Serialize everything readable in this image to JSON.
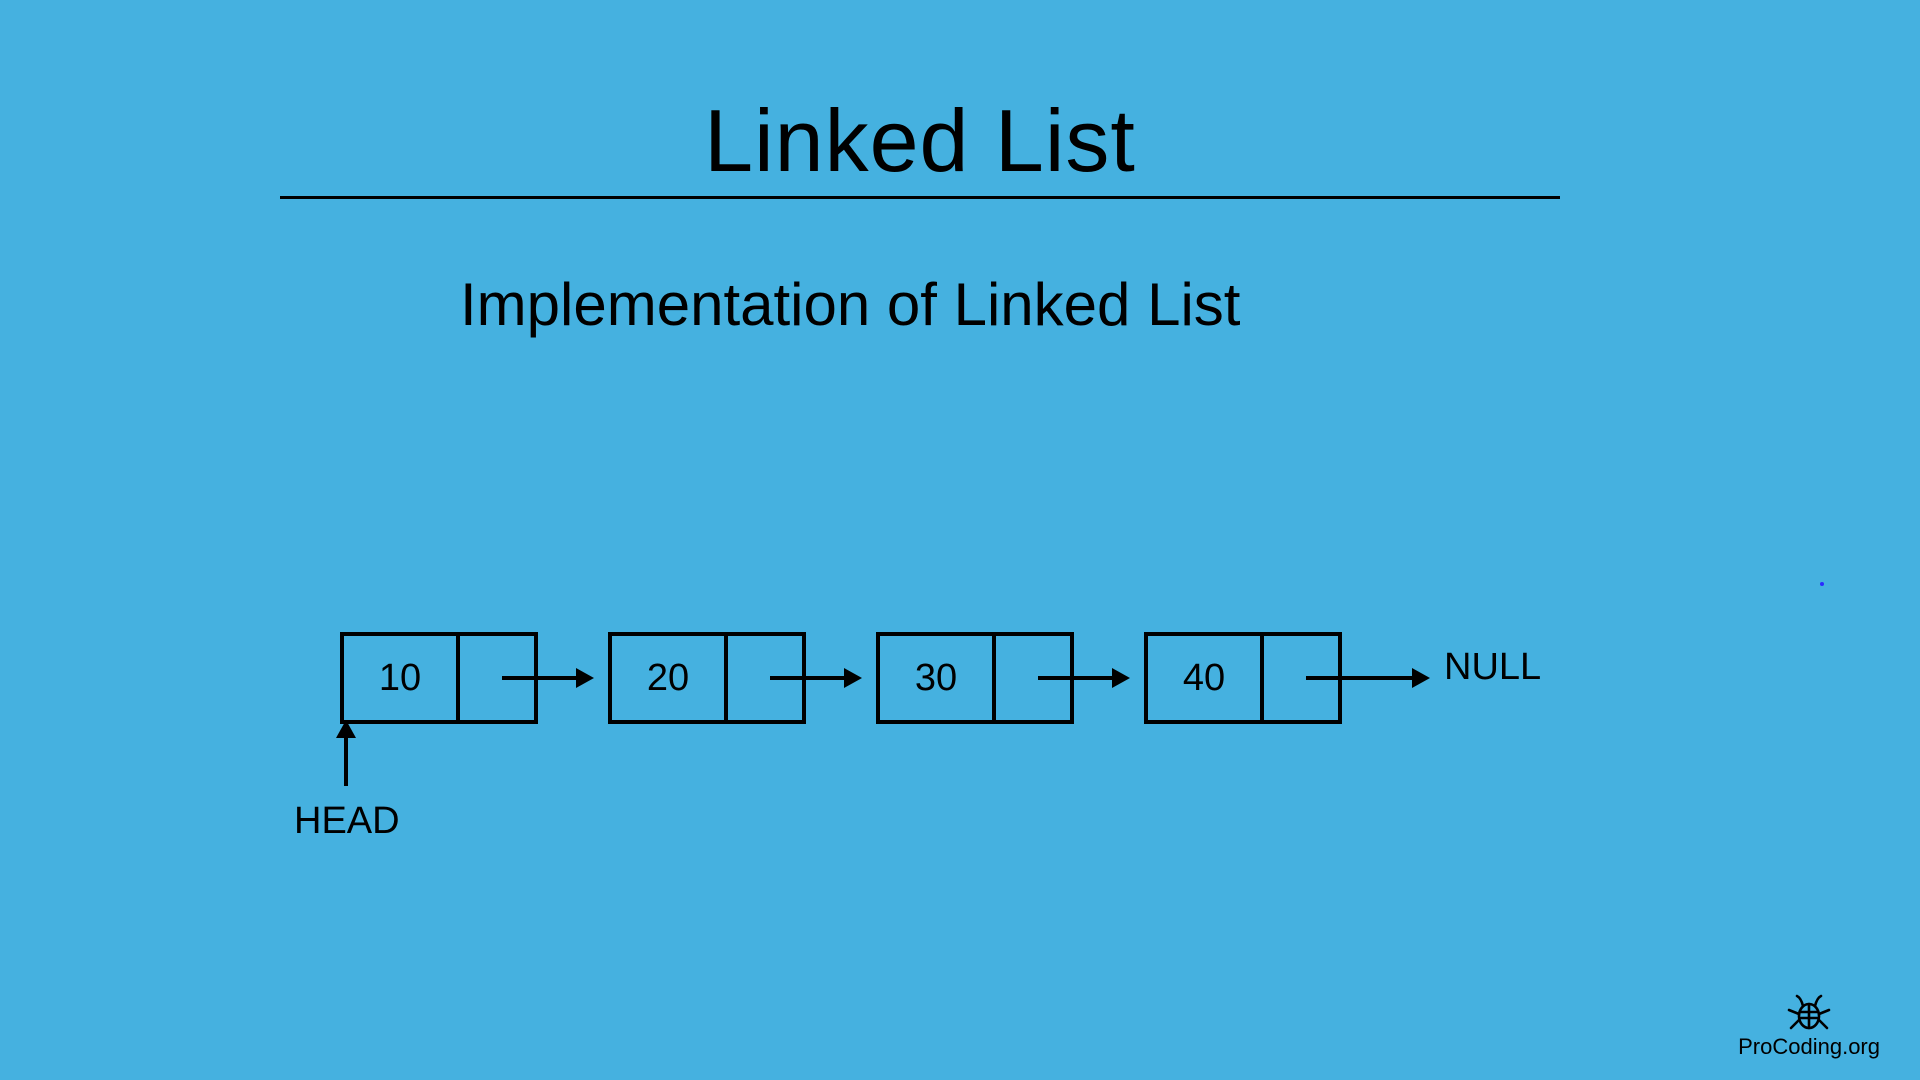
{
  "title": "Linked List",
  "subtitle": "Implementation of Linked List",
  "diagram": {
    "head_label": "HEAD",
    "null_label": "NULL",
    "nodes": [
      {
        "value": "10"
      },
      {
        "value": "20"
      },
      {
        "value": "30"
      },
      {
        "value": "40"
      }
    ]
  },
  "brand": "ProCoding.org"
}
